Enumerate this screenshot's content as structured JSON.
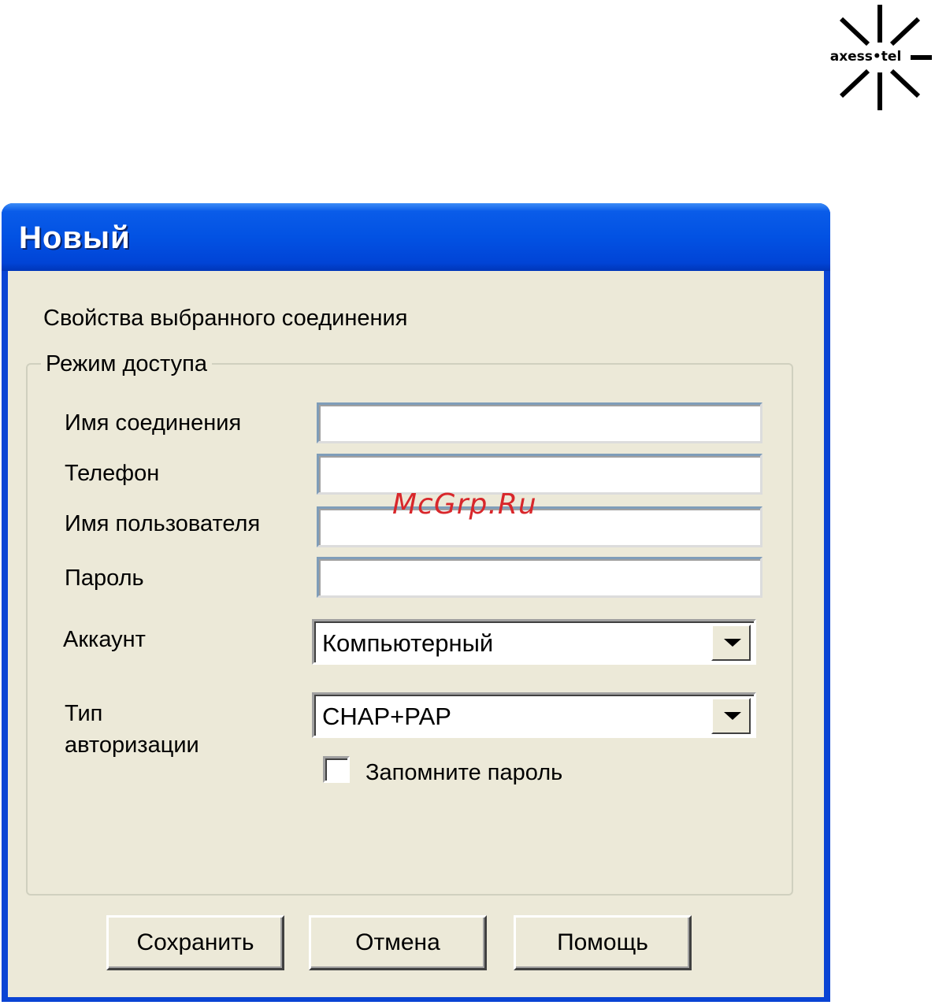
{
  "logo": {
    "text": "axess•tel",
    "icon": "axesstel-star-logo"
  },
  "window": {
    "title": "Новый"
  },
  "dialog": {
    "intro": "Свойства выбранного соединения",
    "group_title": "Режим доступа",
    "fields": [
      {
        "label": "Имя соединения",
        "value": ""
      },
      {
        "label": "Телефон",
        "value": ""
      },
      {
        "label": "Имя пользователя",
        "value": ""
      },
      {
        "label": "Пароль",
        "value": ""
      }
    ],
    "account": {
      "label": "Аккаунт",
      "value": "Компьютерный"
    },
    "auth": {
      "label_line1": "Тип",
      "label_line2": "авторизации",
      "value": "CHAP+PAP"
    },
    "remember": {
      "label": "Запомните пароль",
      "checked": false
    }
  },
  "buttons": {
    "save": "Сохранить",
    "cancel": "Отмена",
    "help": "Помощь"
  },
  "watermark": "McGrp.Ru"
}
